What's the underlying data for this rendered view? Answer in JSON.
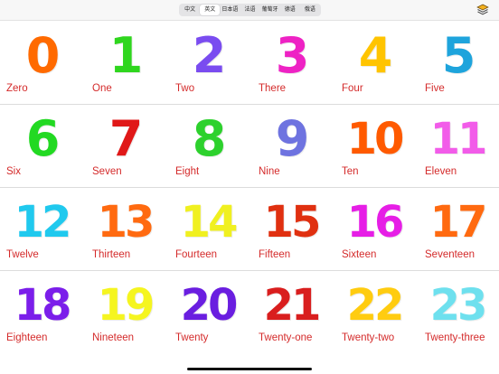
{
  "languages": [
    {
      "label": "中文",
      "active": false
    },
    {
      "label": "英文",
      "active": true
    },
    {
      "label": "日本语",
      "active": false
    },
    {
      "label": "法语",
      "active": false
    },
    {
      "label": "葡萄牙",
      "active": false
    },
    {
      "label": "德语",
      "active": false
    },
    {
      "label": "俄语",
      "active": false
    }
  ],
  "toolbar": {
    "layers_icon": "layers-icon"
  },
  "numbers": [
    {
      "numeral": "0",
      "word": "Zero",
      "color": "#ff6a00"
    },
    {
      "numeral": "1",
      "word": "One",
      "color": "#2fd61e"
    },
    {
      "numeral": "2",
      "word": "Two",
      "color": "#7a4cf0"
    },
    {
      "numeral": "3",
      "word": "There",
      "color": "#ee22c4"
    },
    {
      "numeral": "4",
      "word": "Four",
      "color": "#ffc400"
    },
    {
      "numeral": "5",
      "word": "Five",
      "color": "#1ea4dc"
    },
    {
      "numeral": "6",
      "word": "Six",
      "color": "#22d922"
    },
    {
      "numeral": "7",
      "word": "Seven",
      "color": "#e01818"
    },
    {
      "numeral": "8",
      "word": "Eight",
      "color": "#2dd12d"
    },
    {
      "numeral": "9",
      "word": "Nine",
      "color": "#6e73e0"
    },
    {
      "numeral": "10",
      "word": "Ten",
      "color": "#ff5a00"
    },
    {
      "numeral": "11",
      "word": "Eleven",
      "color": "#f25ce9"
    },
    {
      "numeral": "12",
      "word": "Twelve",
      "color": "#20c9ee"
    },
    {
      "numeral": "13",
      "word": "Thirteen",
      "color": "#ff6a10"
    },
    {
      "numeral": "14",
      "word": "Fourteen",
      "color": "#f0f020"
    },
    {
      "numeral": "15",
      "word": "Fifteen",
      "color": "#e03010"
    },
    {
      "numeral": "16",
      "word": "Sixteen",
      "color": "#e61ee6"
    },
    {
      "numeral": "17",
      "word": "Seventeen",
      "color": "#ff6a10"
    },
    {
      "numeral": "18",
      "word": "Eighteen",
      "color": "#7b1eea"
    },
    {
      "numeral": "19",
      "word": "Nineteen",
      "color": "#f5f520"
    },
    {
      "numeral": "20",
      "word": "Twenty",
      "color": "#6a1ee0"
    },
    {
      "numeral": "21",
      "word": "Twenty-one",
      "color": "#d91e1e"
    },
    {
      "numeral": "22",
      "word": "Twenty-two",
      "color": "#ffcc10"
    },
    {
      "numeral": "23",
      "word": "Twenty-three",
      "color": "#6ee0ee"
    }
  ]
}
